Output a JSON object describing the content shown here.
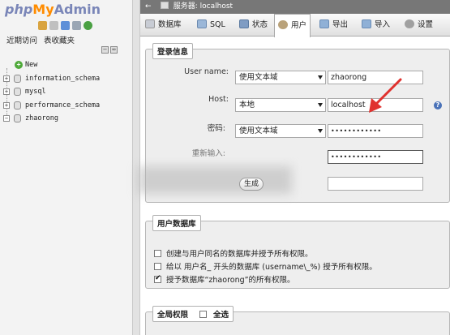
{
  "logo": {
    "part1": "php",
    "part2": "My",
    "part3": "Admin"
  },
  "nav": {
    "tabs": [
      "近期访问",
      "表收藏夹"
    ],
    "databases": [
      {
        "name": "New",
        "type": "new"
      },
      {
        "name": "information_schema",
        "type": "db"
      },
      {
        "name": "mysql",
        "type": "db"
      },
      {
        "name": "performance_schema",
        "type": "db"
      },
      {
        "name": "zhaorong",
        "type": "db"
      }
    ]
  },
  "server_bar": {
    "text": "服务器: localhost"
  },
  "tabs": [
    {
      "label": "数据库",
      "icon": "database-icon",
      "active": false
    },
    {
      "label": "SQL",
      "icon": "sql-icon",
      "active": false
    },
    {
      "label": "状态",
      "icon": "status-icon",
      "active": false
    },
    {
      "label": "用户",
      "icon": "users-icon",
      "active": true
    },
    {
      "label": "导出",
      "icon": "export-icon",
      "active": false
    },
    {
      "label": "导入",
      "icon": "import-icon",
      "active": false
    },
    {
      "label": "设置",
      "icon": "settings-icon",
      "active": false
    }
  ],
  "login": {
    "legend": "登录信息",
    "user_label": "User name:",
    "user_select": "使用文本域",
    "user_value": "zhaorong",
    "host_label": "Host:",
    "host_select": "本地",
    "host_value": "localhost",
    "pw_label": "密码:",
    "pw_select": "使用文本域",
    "pw_value": "••••••••••••",
    "repw_label": "重新输入:",
    "repw_value": "••••••••••••",
    "generate_label": "生成"
  },
  "userdb": {
    "legend": "用户数据库",
    "options": [
      {
        "label": "创建与用户同名的数据库并授予所有权限。",
        "checked": false
      },
      {
        "label": "给以 用户名_ 开头的数据库 (username\\_%) 授予所有权限。",
        "checked": false
      },
      {
        "label": "授予数据库“zhaorong”的所有权限。",
        "checked": true
      }
    ]
  },
  "global": {
    "legend": "全局权限",
    "select_all": "全选"
  },
  "colors": {
    "accent": "#e0312e",
    "server_bar": "#777777",
    "panel": "#eeeeee"
  }
}
